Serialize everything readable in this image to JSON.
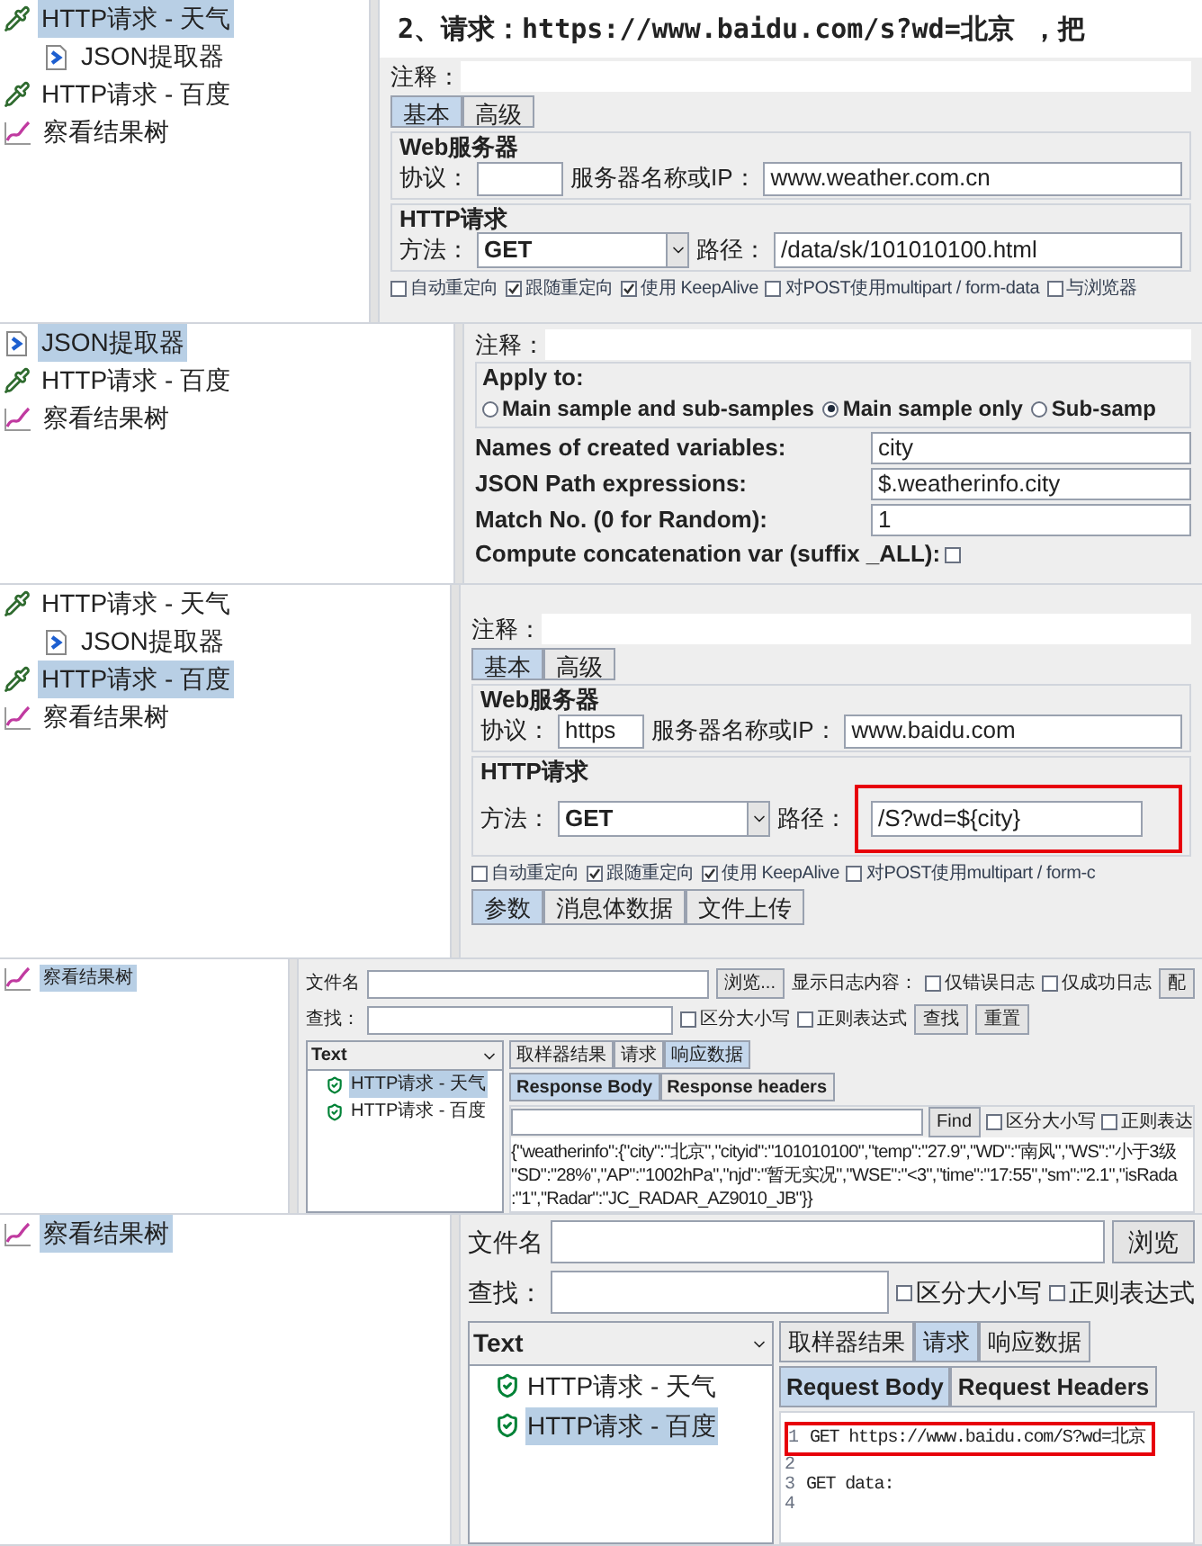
{
  "panels": [
    {
      "kind": "http_sampler",
      "tree": [
        {
          "label": "HTTP请求 - 天气",
          "kind": "sampler",
          "selected": true,
          "children": [
            {
              "label": "JSON提取器",
              "kind": "extractor",
              "selected": false
            }
          ]
        },
        {
          "label": "HTTP请求 - 百度",
          "kind": "sampler",
          "selected": false
        },
        {
          "label": "察看结果树",
          "kind": "listener",
          "selected": false
        }
      ],
      "heading": "2、请求：https://www.baidu.com/s?wd=北京 ，把",
      "comment_label": "注释：",
      "tabs": [
        {
          "label": "基本",
          "selected": true
        },
        {
          "label": "高级",
          "selected": false
        }
      ],
      "web_server": {
        "title": "Web服务器",
        "protocol_label": "协议：",
        "server_label": "服务器名称或IP：",
        "server": "www.weather.com.cn"
      },
      "http_request": {
        "title": "HTTP请求",
        "method_label": "方法：",
        "method": "GET",
        "path_label": "路径：",
        "path": "/data/sk/101010100.html",
        "highlighted": false
      },
      "options": [
        {
          "label": "自动重定向",
          "checked": false
        },
        {
          "label": "跟随重定向",
          "checked": true
        },
        {
          "label": "使用 KeepAlive",
          "checked": true
        },
        {
          "label": "对POST使用multipart / form-data",
          "checked": false
        },
        {
          "label": "与浏览器",
          "checked": false
        }
      ]
    },
    {
      "kind": "json_extractor",
      "tree": [
        {
          "label": "JSON提取器",
          "kind": "extractor",
          "selected": true
        },
        {
          "label": "HTTP请求 - 百度",
          "kind": "sampler",
          "selected": false
        },
        {
          "label": "察看结果树",
          "kind": "listener",
          "selected": false
        }
      ],
      "comment_label": "注释：",
      "apply_label": "Apply to:",
      "apply_options": [
        {
          "label": "Main sample and sub-samples",
          "selected": false
        },
        {
          "label": "Main sample only",
          "selected": true
        },
        {
          "label": "Sub-samp",
          "selected": false
        }
      ],
      "fields": [
        {
          "label": "Names of created variables:",
          "value": "city"
        },
        {
          "label": "JSON Path expressions:",
          "value": "$.weatherinfo.city"
        },
        {
          "label": "Match No. (0 for Random):",
          "value": "1"
        }
      ],
      "concat": {
        "label": "Compute concatenation var (suffix _ALL):",
        "checked": false
      }
    },
    {
      "kind": "http_sampler",
      "tree": [
        {
          "label": "HTTP请求 - 天气",
          "kind": "sampler",
          "selected": false,
          "children": [
            {
              "label": "JSON提取器",
              "kind": "extractor",
              "selected": false
            }
          ]
        },
        {
          "label": "HTTP请求 - 百度",
          "kind": "sampler",
          "selected": true
        },
        {
          "label": "察看结果树",
          "kind": "listener",
          "selected": false
        }
      ],
      "comment_label": "注释：",
      "tabs": [
        {
          "label": "基本",
          "selected": true
        },
        {
          "label": "高级",
          "selected": false
        }
      ],
      "web_server": {
        "title": "Web服务器",
        "protocol_label": "协议：",
        "protocol": "https",
        "server_label": "服务器名称或IP：",
        "server": "www.baidu.com"
      },
      "http_request": {
        "title": "HTTP请求",
        "method_label": "方法：",
        "method": "GET",
        "path_label": "路径：",
        "path": "/S?wd=${city}",
        "highlighted": true
      },
      "options": [
        {
          "label": "自动重定向",
          "checked": false
        },
        {
          "label": "跟随重定向",
          "checked": true
        },
        {
          "label": "使用 KeepAlive",
          "checked": true
        },
        {
          "label": "对POST使用multipart / form-c",
          "checked": false
        }
      ],
      "bottom_tabs": [
        {
          "label": "参数",
          "selected": true
        },
        {
          "label": "消息体数据",
          "selected": false
        },
        {
          "label": "文件上传",
          "selected": false
        }
      ]
    },
    {
      "kind": "results_tree",
      "tree": [
        {
          "label": "察看结果树",
          "kind": "listener",
          "selected": true
        }
      ],
      "file_label": "文件名",
      "browse_button": "浏览...",
      "log_label": "显示日志内容：",
      "log_options": [
        {
          "label": "仅错误日志",
          "checked": false
        },
        {
          "label": "仅成功日志",
          "checked": false
        }
      ],
      "config_button": "配",
      "search_label": "查找：",
      "search_options": [
        {
          "label": "区分大小写",
          "checked": false
        },
        {
          "label": "正则表达式",
          "checked": false
        }
      ],
      "search_buttons": [
        "查找",
        "重置"
      ],
      "list_header": "Text",
      "results": [
        {
          "label": "HTTP请求 - 天气",
          "selected": true
        },
        {
          "label": "HTTP请求 - 百度",
          "selected": false
        }
      ],
      "tabs": [
        {
          "label": "取样器结果",
          "selected": false
        },
        {
          "label": "请求",
          "selected": false
        },
        {
          "label": "响应数据",
          "selected": true
        }
      ],
      "sub_tabs": [
        {
          "label": "Response Body",
          "selected": true
        },
        {
          "label": "Response headers",
          "selected": false
        }
      ],
      "body": {
        "kind": "response",
        "find_button": "Find",
        "find_options": [
          {
            "label": "区分大小写",
            "checked": false
          },
          {
            "label": "正则表达",
            "checked": false
          }
        ],
        "lines": [
          "{\"weatherinfo\":{\"city\":\"北京\",\"cityid\":\"101010100\",\"temp\":\"27.9\",\"WD\":\"南风\",\"WS\":\"小于3级",
          "\"SD\":\"28%\",\"AP\":\"1002hPa\",\"njd\":\"暂无实况\",\"WSE\":\"<3\",\"time\":\"17:55\",\"sm\":\"2.1\",\"isRada",
          ":\"1\",\"Radar\":\"JC_RADAR_AZ9010_JB\"}}"
        ]
      }
    },
    {
      "kind": "results_tree",
      "tree": [
        {
          "label": "察看结果树",
          "kind": "listener",
          "selected": true
        }
      ],
      "file_label": "文件名",
      "browse_button": "浏览",
      "search_label": "查找：",
      "search_options": [
        {
          "label": "区分大小写",
          "checked": false
        },
        {
          "label": "正则表达式",
          "checked": false
        }
      ],
      "list_header": "Text",
      "results": [
        {
          "label": "HTTP请求 - 天气",
          "selected": false
        },
        {
          "label": "HTTP请求 - 百度",
          "selected": true
        }
      ],
      "tabs": [
        {
          "label": "取样器结果",
          "selected": false
        },
        {
          "label": "请求",
          "selected": true
        },
        {
          "label": "响应数据",
          "selected": false
        }
      ],
      "sub_tabs": [
        {
          "label": "Request Body",
          "selected": true
        },
        {
          "label": "Request Headers",
          "selected": false
        }
      ],
      "body": {
        "kind": "request",
        "lines": [
          {
            "number": "1",
            "text": "GET https://www.baidu.com/S?wd=北京",
            "highlighted": true
          },
          {
            "number": "2",
            "highlighted": false
          },
          {
            "number": "3",
            "text": "GET data:",
            "highlighted": false
          },
          {
            "number": "4",
            "highlighted": false
          }
        ]
      }
    }
  ]
}
